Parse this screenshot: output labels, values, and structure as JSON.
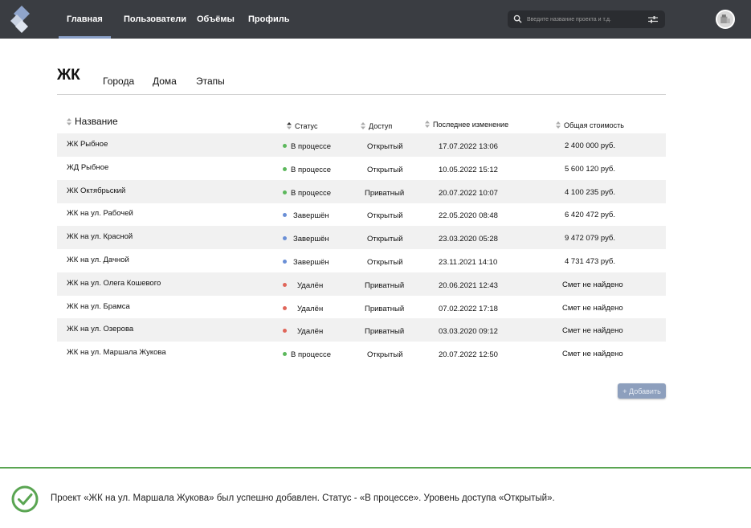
{
  "nav": {
    "items": [
      "Главная",
      "Пользователи",
      "Объёмы",
      "Профиль"
    ],
    "active": "Главная"
  },
  "search": {
    "placeholder": "Введите название проекта и т.д."
  },
  "tabs": {
    "main": "ЖК",
    "items": [
      "Города",
      "Дома",
      "Этапы"
    ]
  },
  "table": {
    "columns": [
      "Название",
      "Статус",
      "Доступ",
      "Последнее изменение",
      "Общая стоимость"
    ],
    "rows": [
      {
        "name": "ЖК Рыбное",
        "status": "В процессе",
        "access": "Открытый",
        "modified": "17.07.2022 13:06",
        "cost": "2 400 000 руб."
      },
      {
        "name": "ЖД Рыбное",
        "status": "В процессе",
        "access": "Открытый",
        "modified": "10.05.2022 15:12",
        "cost": "5 600 120 руб."
      },
      {
        "name": "ЖК Октябрьский",
        "status": "В процессе",
        "access": "Приватный",
        "modified": "20.07.2022 10:07",
        "cost": "4 100 235 руб."
      },
      {
        "name": "ЖК на ул. Рабочей",
        "status": "Завершён",
        "access": "Открытый",
        "modified": "22.05.2020 08:48",
        "cost": "6 420 472 руб."
      },
      {
        "name": "ЖК на ул. Красной",
        "status": "Завершён",
        "access": "Открытый",
        "modified": "23.03.2020 05:28",
        "cost": "9 472 079 руб."
      },
      {
        "name": "ЖК на ул. Дачной",
        "status": "Завершён",
        "access": "Открытый",
        "modified": "23.11.2021 14:10",
        "cost": "4 731 473 руб."
      },
      {
        "name": "ЖК на ул. Олега Кошевого",
        "status": "Удалён",
        "access": "Приватный",
        "modified": "20.06.2021 12:43",
        "cost": "Смет не найдено"
      },
      {
        "name": "ЖК на ул. Брамса",
        "status": "Удалён",
        "access": "Приватный",
        "modified": "07.02.2022 17:18",
        "cost": "Смет не найдено"
      },
      {
        "name": "ЖК на ул. Озерова",
        "status": "Удалён",
        "access": "Приватный",
        "modified": "03.03.2020 09:12",
        "cost": "Смет не найдено"
      },
      {
        "name": "ЖК на ул. Маршала Жукова",
        "status": "В процессе",
        "access": "Открытый",
        "modified": "20.07.2022 12:50",
        "cost": "Смет не найдено"
      }
    ]
  },
  "status_colors": {
    "В процессе": "#5cb85c",
    "Завершён": "#6a8fd6",
    "Удалён": "#e0665a"
  },
  "add_button": {
    "label": "Добавить",
    "icon": "plus-icon"
  },
  "notification": {
    "text": "Проект «ЖК на ул. Маршала Жукова» был успешно добавлен. Статус - «В процессе». Уровень доступа «Открытый».",
    "icon": "check-circle-icon",
    "accent": "#5aa552"
  },
  "colors": {
    "topbar": "#3a3d42",
    "nav_active_underline": "#8aa0c8",
    "row_shade": "#f1f1f1",
    "button": "#8d9fbd"
  }
}
